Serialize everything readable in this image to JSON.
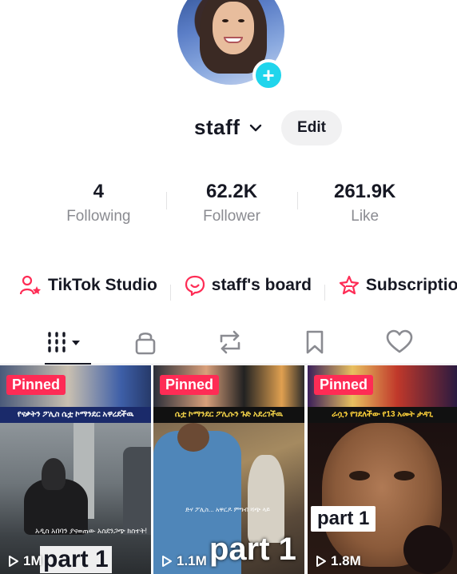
{
  "profile": {
    "username": "staff",
    "edit_label": "Edit"
  },
  "stats": [
    {
      "value": "4",
      "label": "Following"
    },
    {
      "value": "62.2K",
      "label": "Follower"
    },
    {
      "value": "261.9K",
      "label": "Like"
    }
  ],
  "quick_links": {
    "studio": "TikTok Studio",
    "board": "staff's board",
    "subscription": "Subscriptio"
  },
  "tabs": [
    "videos-icon",
    "lock-icon",
    "repost-icon",
    "bookmark-icon",
    "heart-icon"
  ],
  "videos": [
    {
      "pinned_label": "Pinned",
      "views": "1M",
      "part_label": "part 1",
      "banner": "የናቃትን ፖሊስ ሴቷ ኮማንደር አዋረደችዉ",
      "caption": "አዲስ አበባን ያናወጠው አስደንጋጭ ክስተት!"
    },
    {
      "pinned_label": "Pinned",
      "views": "1.1M",
      "part_label": "part 1",
      "banner": "ሴቷ ኮማንደር ፖሊሱን ጉድ አደረገችዉ",
      "caption": "ድሃ ፖሊስ... አዋርዶ ምግብ ሻጭ ላይ"
    },
    {
      "pinned_label": "Pinned",
      "views": "1.8M",
      "part_label": "part 1",
      "banner": "ራሷን የገደለችው የ13 አመት ታዳጊ",
      "caption": ""
    }
  ],
  "colors": {
    "accent_pink": "#fe2c55",
    "add_badge": "#20d5ec",
    "text_primary": "#161823",
    "text_secondary": "#8a8b91"
  }
}
